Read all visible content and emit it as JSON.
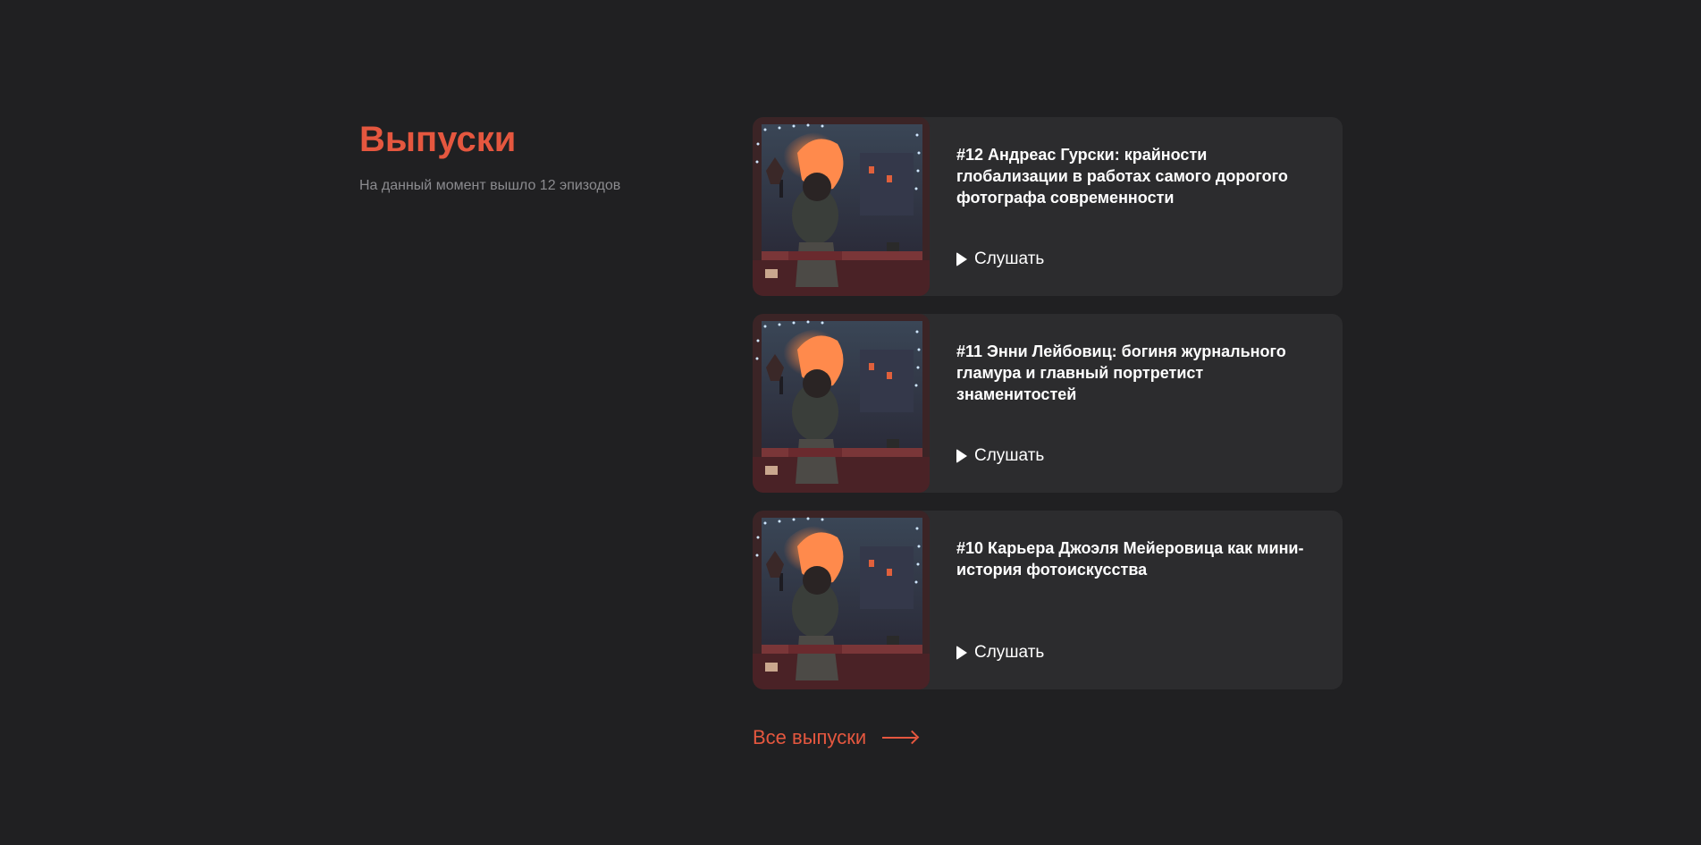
{
  "section": {
    "title": "Выпуски",
    "subtitle": "На данный момент вышло 12 эпизодов"
  },
  "episodes": [
    {
      "title": "#12 Андреас Гурски: крайности глобализации в работах самого дорогого фотографа современности",
      "listen_label": "Слушать"
    },
    {
      "title": "#11 Энни Лейбовиц: богиня журнального гламура и главный портретист знаменитостей",
      "listen_label": "Слушать"
    },
    {
      "title": "#10 Карьера Джоэля Мейеровица как мини-история фотоискусства",
      "listen_label": "Слушать"
    }
  ],
  "footer_link": {
    "label": "Все выпуски"
  },
  "colors": {
    "background": "#202022",
    "card": "#2C2C2E",
    "accent": "#E5573F",
    "muted_text": "#8B8B8F"
  },
  "icons": {
    "listen": "play-icon",
    "all_episodes": "arrow-right-icon",
    "cover": "podcast-cover-artwork"
  }
}
